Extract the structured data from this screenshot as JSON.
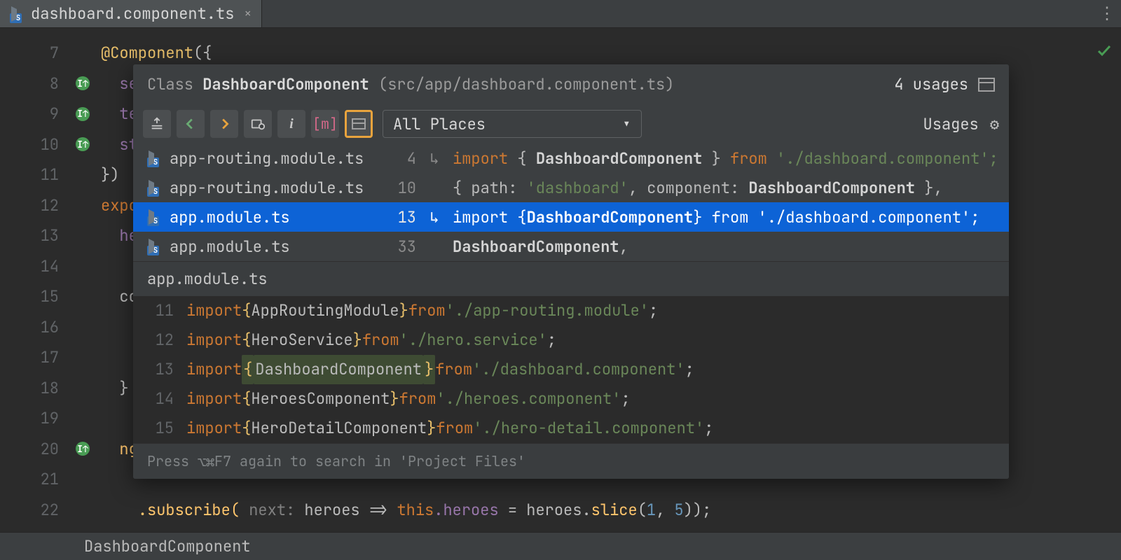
{
  "tab": {
    "filename": "dashboard.component.ts"
  },
  "gutter_start": 7,
  "gutter_lines": 16,
  "marked_lines": [
    8,
    9,
    10,
    20
  ],
  "editor": {
    "decorator": "@Component",
    "selector_label": "se",
    "template_label": "te",
    "styles_label": "st",
    "export_kw": "expo",
    "heroes_line": "  he",
    "cons_line": "  co",
    "closebrace": "  }",
    "ng_line": "  ng",
    "subscribe": ".subscribe(",
    "subscribe_hint": " next: ",
    "subscribe_rest": "heroes => ",
    "subscribe_this": "this",
    "subscribe_field": ".heroes",
    "subscribe_eq": " = heroes.",
    "subscribe_fn": "slice",
    "subscribe_args": "(1, 5));"
  },
  "popup": {
    "class_label": "Class ",
    "class_name": "DashboardComponent",
    "path": " (src/app/dashboard.component.ts)",
    "count": "4 usages",
    "scope": "All Places",
    "usages_label": "Usages",
    "preview_file": "app.module.ts",
    "hint": "Press ⌥⌘F7 again to search in 'Project Files'",
    "rows": [
      {
        "file": "app-routing.module.ts",
        "line": "4",
        "icon": true,
        "kw": "import",
        "pre": " { ",
        "sym": "DashboardComponent",
        "post": " } ",
        "kw2": "from",
        "str": " './dashboard.component';",
        "selected": false
      },
      {
        "file": "app-routing.module.ts",
        "line": "10",
        "icon": false,
        "kw": "",
        "pre": "  { path: ",
        "str0": "'dashboard'",
        "mid": ", component: ",
        "sym": "DashboardComponent",
        "post": " },",
        "selected": false
      },
      {
        "file": "app.module.ts",
        "line": "13",
        "icon": true,
        "kw": "import",
        "pre": " {",
        "sym": "DashboardComponent",
        "post": "} ",
        "kw2": "from",
        "str": " './dashboard.component';",
        "selected": true
      },
      {
        "file": "app.module.ts",
        "line": "33",
        "icon": false,
        "kw": "",
        "pre": "  ",
        "sym": "DashboardComponent",
        "post": ",",
        "selected": false
      }
    ],
    "preview_lines": [
      {
        "n": "11",
        "kw": "import ",
        "brace": "{",
        "id": "AppRoutingModule",
        "brace2": "} ",
        "kw2": "from ",
        "str": "'./app-routing.module'",
        "end": ";"
      },
      {
        "n": "12",
        "kw": "import ",
        "brace": "{",
        "id": "HeroService",
        "brace2": "} ",
        "kw2": "from ",
        "str": "'./hero.service'",
        "end": ";"
      },
      {
        "n": "13",
        "kw": "import ",
        "brace": "{",
        "id": "DashboardComponent",
        "brace2": "} ",
        "kw2": "from ",
        "str": "'./dashboard.component'",
        "end": ";",
        "hl": true
      },
      {
        "n": "14",
        "kw": "import ",
        "brace": "{",
        "id": "HeroesComponent",
        "brace2": "} ",
        "kw2": "from ",
        "str": "'./heroes.component'",
        "end": ";"
      },
      {
        "n": "15",
        "kw": "import ",
        "brace": "{",
        "id": "HeroDetailComponent",
        "brace2": "} ",
        "kw2": "from ",
        "str": "'./hero-detail.component'",
        "end": ";"
      }
    ]
  },
  "statusbar": {
    "text": "DashboardComponent"
  }
}
